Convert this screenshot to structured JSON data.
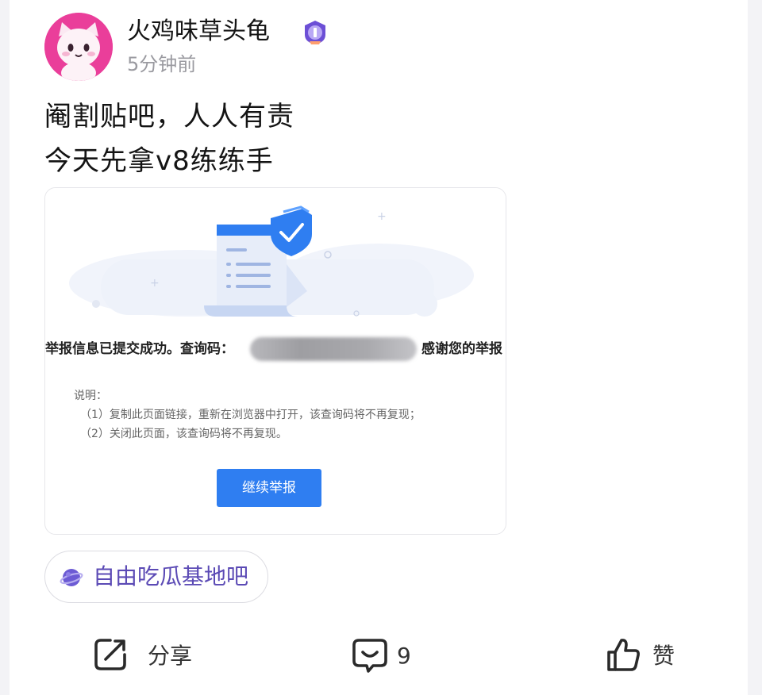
{
  "header": {
    "username": "火鸡味草头龟",
    "timestamp": "5分钟前"
  },
  "post": {
    "lines": [
      "阉割贴吧，人人有责",
      "今天先拿v8练练手"
    ]
  },
  "screenshot": {
    "success_text": "举报信息已提交成功。查询码：",
    "thanks_text": "感谢您的举报",
    "note_title": "说明：",
    "notes": [
      "（1）复制此页面链接，重新在浏览器中打开，该查询码将不再复现；",
      "（2）关闭此页面，该查询码将不再复现。"
    ],
    "button_label": "继续举报"
  },
  "forum": {
    "name": "自由吃瓜基地吧",
    "icon": "planet-icon"
  },
  "actions": {
    "share_label": "分享",
    "comment_count": "9",
    "like_label": "赞"
  },
  "colors": {
    "avatar_bg": "#ea3e9a",
    "forum_text": "#5b4ab5",
    "button_blue": "#2f7ef1"
  }
}
